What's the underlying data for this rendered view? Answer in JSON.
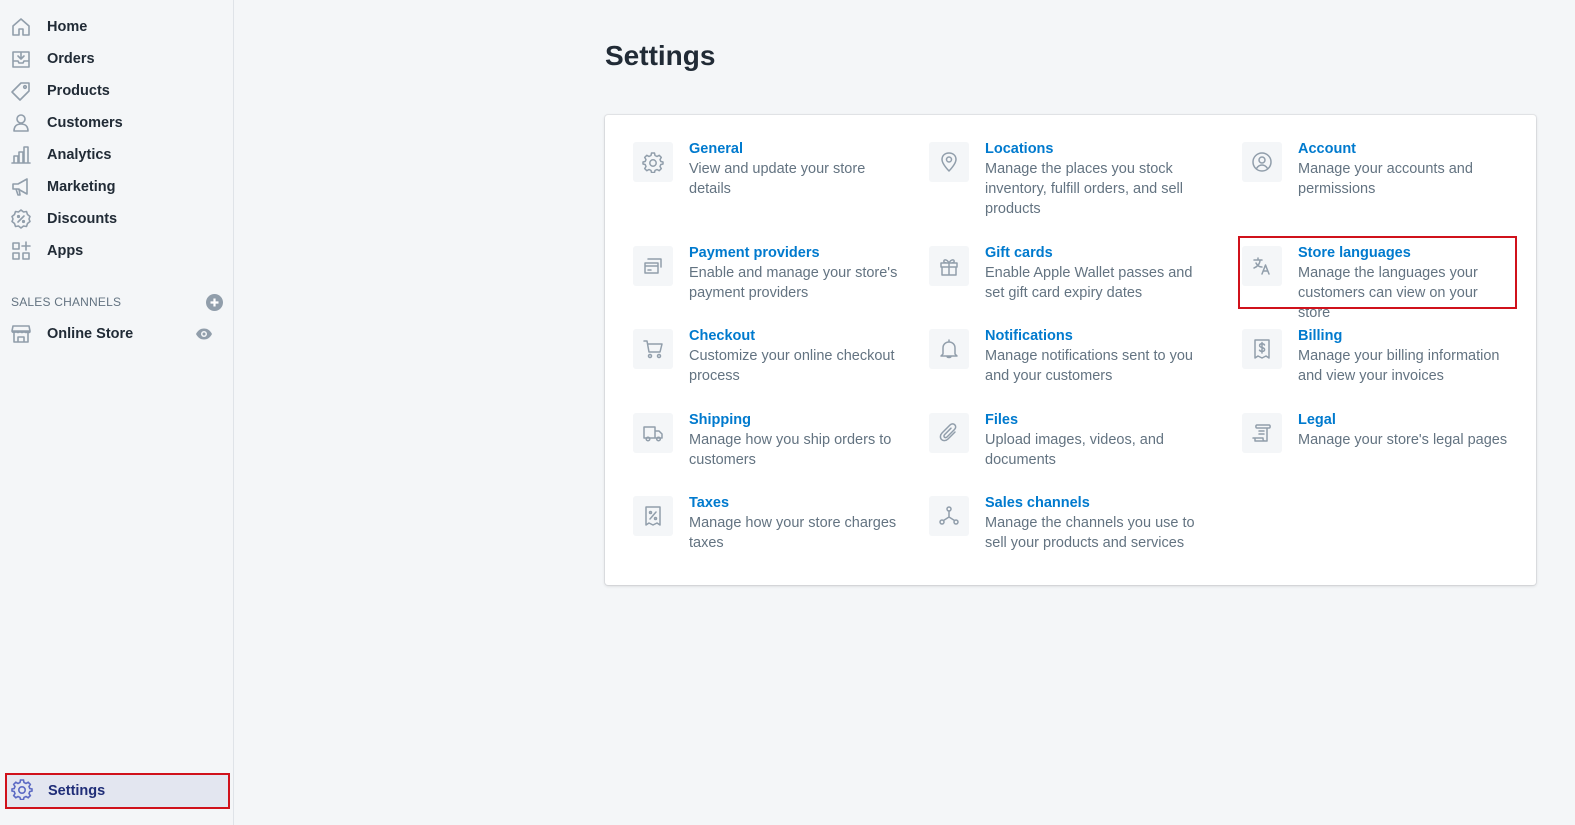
{
  "sidebar": {
    "items": [
      {
        "label": "Home",
        "icon": "home-icon"
      },
      {
        "label": "Orders",
        "icon": "orders-icon"
      },
      {
        "label": "Products",
        "icon": "tag-icon"
      },
      {
        "label": "Customers",
        "icon": "person-icon"
      },
      {
        "label": "Analytics",
        "icon": "bar-chart-icon"
      },
      {
        "label": "Marketing",
        "icon": "megaphone-icon"
      },
      {
        "label": "Discounts",
        "icon": "discount-icon"
      },
      {
        "label": "Apps",
        "icon": "apps-icon"
      }
    ],
    "sales_channels_title": "SALES CHANNELS",
    "online_store": "Online Store",
    "settings": "Settings"
  },
  "page": {
    "title": "Settings"
  },
  "settings": [
    {
      "name": "General",
      "desc": "View and update your store details",
      "icon": "gear-icon"
    },
    {
      "name": "Locations",
      "desc": "Manage the places you stock inventory, fulfill orders, and sell products",
      "icon": "location-pin-icon"
    },
    {
      "name": "Account",
      "desc": "Manage your accounts and permissions",
      "icon": "account-icon"
    },
    {
      "name": "Payment providers",
      "desc": "Enable and manage your store's payment providers",
      "icon": "payment-icon"
    },
    {
      "name": "Gift cards",
      "desc": "Enable Apple Wallet passes and set gift card expiry dates",
      "icon": "gift-icon"
    },
    {
      "name": "Store languages",
      "desc": "Manage the languages your customers can view on your store",
      "icon": "translate-icon"
    },
    {
      "name": "Checkout",
      "desc": "Customize your online checkout process",
      "icon": "cart-icon"
    },
    {
      "name": "Notifications",
      "desc": "Manage notifications sent to you and your customers",
      "icon": "bell-icon"
    },
    {
      "name": "Billing",
      "desc": "Manage your billing information and view your invoices",
      "icon": "billing-icon"
    },
    {
      "name": "Shipping",
      "desc": "Manage how you ship orders to customers",
      "icon": "truck-icon"
    },
    {
      "name": "Files",
      "desc": "Upload images, videos, and documents",
      "icon": "paperclip-icon"
    },
    {
      "name": "Legal",
      "desc": "Manage your store's legal pages",
      "icon": "legal-icon"
    },
    {
      "name": "Taxes",
      "desc": "Manage how your store charges taxes",
      "icon": "tax-receipt-icon"
    },
    {
      "name": "Sales channels",
      "desc": "Manage the channels you use to sell your products and services",
      "icon": "channels-icon"
    }
  ],
  "colors": {
    "link": "#007ace",
    "highlight": "#d0111b",
    "active_nav_bg": "#e3e6f0"
  }
}
